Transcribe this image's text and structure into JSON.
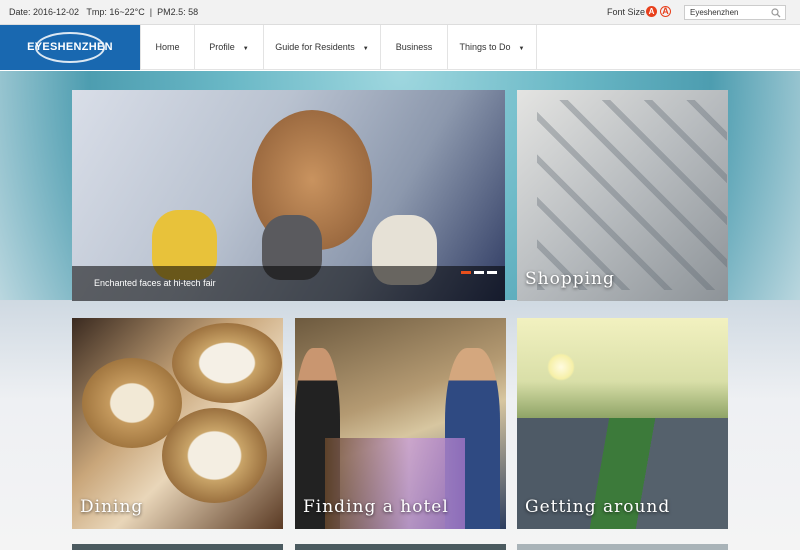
{
  "topbar": {
    "date_text": "Date: 2016-12-02",
    "temp_text": "Tmp: 16~22°C",
    "pm_text": "PM2.5: 58",
    "font_size_label": "Font Size",
    "font_small": "A",
    "font_large": "A",
    "search_value": "Eyeshenzhen"
  },
  "nav": {
    "logo_text": "EYESHENZHEN",
    "items": [
      {
        "label": "Home"
      },
      {
        "label": "Profile"
      },
      {
        "label": "Guide for Residents"
      },
      {
        "label": "Business"
      },
      {
        "label": "Things to Do"
      }
    ]
  },
  "feature": {
    "caption": "Enchanted faces at hi-tech fair",
    "slides_total": 3,
    "active_slide": 1
  },
  "tiles": {
    "shopping": "Shopping",
    "dining": "Dining",
    "hotel": "Finding a hotel",
    "around": "Getting around"
  },
  "colors": {
    "brand_blue": "#1968b0",
    "accent_orange": "#e8501c"
  }
}
